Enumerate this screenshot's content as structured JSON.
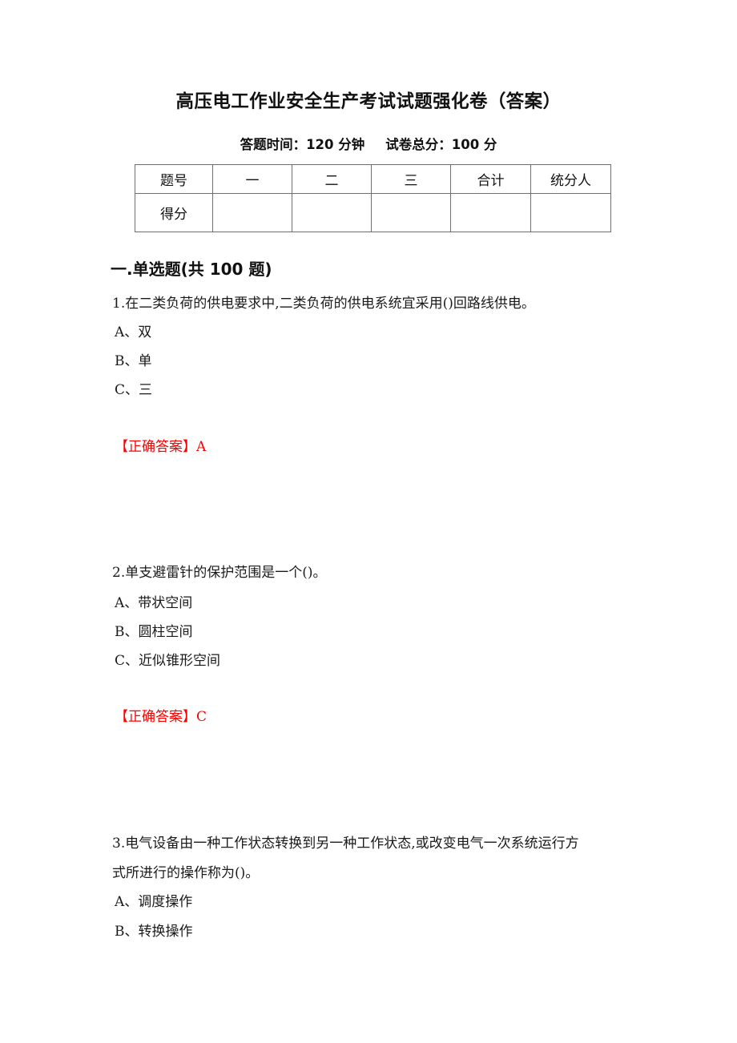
{
  "document": {
    "title": "高压电工作业安全生产考试试题强化卷（答案）",
    "subtitle_time": "答题时间：120 分钟",
    "subtitle_score": "试卷总分：100 分",
    "answer_color": "#ff0000",
    "text_color": "#1a1a1a",
    "border_color": "#6f6f6f"
  },
  "score_table": {
    "header": [
      "题号",
      "一",
      "二",
      "三",
      "合计",
      "统分人"
    ],
    "row_label": "得分",
    "row_values": [
      "",
      "",
      "",
      "",
      ""
    ]
  },
  "sections": [
    {
      "heading": "一.单选题(共 100 题)"
    }
  ],
  "questions": [
    {
      "number": "1",
      "stem_lines": [
        "1.在二类负荷的供电要求中,二类负荷的供电系统宜采用()回路线供电。"
      ],
      "options": [
        {
          "key": "A、",
          "text": "双"
        },
        {
          "key": "B、",
          "text": "单"
        },
        {
          "key": "C、",
          "text": "三"
        }
      ],
      "answer_label": "【正确答案】",
      "answer_value": "A"
    },
    {
      "number": "2",
      "stem_lines": [
        "2.单支避雷针的保护范围是一个()。"
      ],
      "options": [
        {
          "key": "A、",
          "text": "带状空间"
        },
        {
          "key": "B、",
          "text": "圆柱空间"
        },
        {
          "key": "C、",
          "text": "近似锥形空间"
        }
      ],
      "answer_label": "【正确答案】",
      "answer_value": "C"
    },
    {
      "number": "3",
      "stem_lines": [
        "3.电气设备由一种工作状态转换到另一种工作状态,或改变电气一次系统运行方",
        "式所进行的操作称为()。"
      ],
      "options": [
        {
          "key": "A、",
          "text": "调度操作"
        },
        {
          "key": "B、",
          "text": "转换操作"
        }
      ],
      "answer_label": "",
      "answer_value": ""
    }
  ]
}
